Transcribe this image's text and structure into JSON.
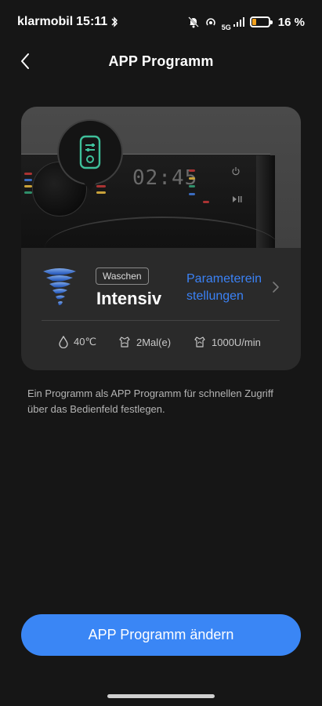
{
  "status_bar": {
    "carrier": "klarmobil",
    "time": "15:11",
    "battery_percent": "16 %",
    "network": "5G",
    "colors": {
      "battery_fill": "#f1a11e"
    }
  },
  "header": {
    "title": "APP Programm",
    "back_icon": "chevron-left-icon"
  },
  "machine_preview": {
    "display_time": "02:45",
    "panel_icon": "washer-control-icon"
  },
  "program": {
    "mode_label": "Waschen",
    "name": "Intensiv",
    "icon": "tornado-icon",
    "settings_link": "Parametereinstellungen",
    "settings_icon": "chevron-right-icon"
  },
  "stats": {
    "temperature": "40℃",
    "rinses": "2Mal(e)",
    "spin": "1000U/min"
  },
  "description": "Ein Programm als APP Programm für schnellen Zugriff über das Bedienfeld festlegen.",
  "actions": {
    "change_program": "APP Programm ändern"
  },
  "colors": {
    "accent": "#3a86f5",
    "link": "#3b82f6",
    "background": "#161616",
    "card": "#2a2a2a"
  }
}
